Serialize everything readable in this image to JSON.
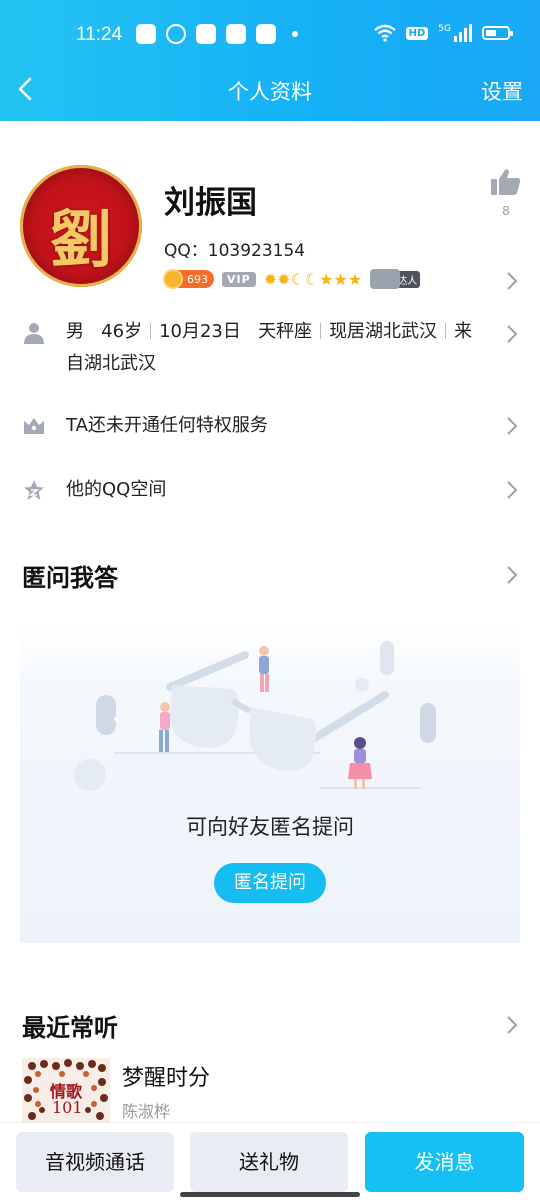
{
  "status_bar": {
    "time": "11:24",
    "network": "5G",
    "hd": "HD"
  },
  "header": {
    "title": "个人资料",
    "settings_label": "设置"
  },
  "profile": {
    "name": "刘振国",
    "avatar_text": "劉",
    "qq_label": "QQ：",
    "qq_number": "103923154",
    "level_points": "693",
    "vip_label": "VIP",
    "level_icons": "✹✹☾☾★★★",
    "daren_label": "达人",
    "likes": "8"
  },
  "info_rows": {
    "basic": [
      "男",
      "46岁",
      "10月23日",
      "天秤座",
      "现居湖北武汉",
      "来自湖北武汉"
    ],
    "privilege": "TA还未开通任何特权服务",
    "qzone": "他的QQ空间"
  },
  "anon_qa": {
    "title": "匿问我答",
    "caption": "可向好友匿名提问",
    "button": "匿名提问"
  },
  "recent_music": {
    "title": "最近常听",
    "cover_text_1": "情歌",
    "cover_text_2": "101",
    "song": "梦醒时分",
    "artist": "陈淑桦"
  },
  "bottom_bar": {
    "call": "音视频通话",
    "gift": "送礼物",
    "message": "发消息"
  },
  "colors": {
    "accent": "#15c0f4",
    "header_gradient_start": "#25c3f3",
    "header_gradient_end": "#1aa8f5"
  }
}
